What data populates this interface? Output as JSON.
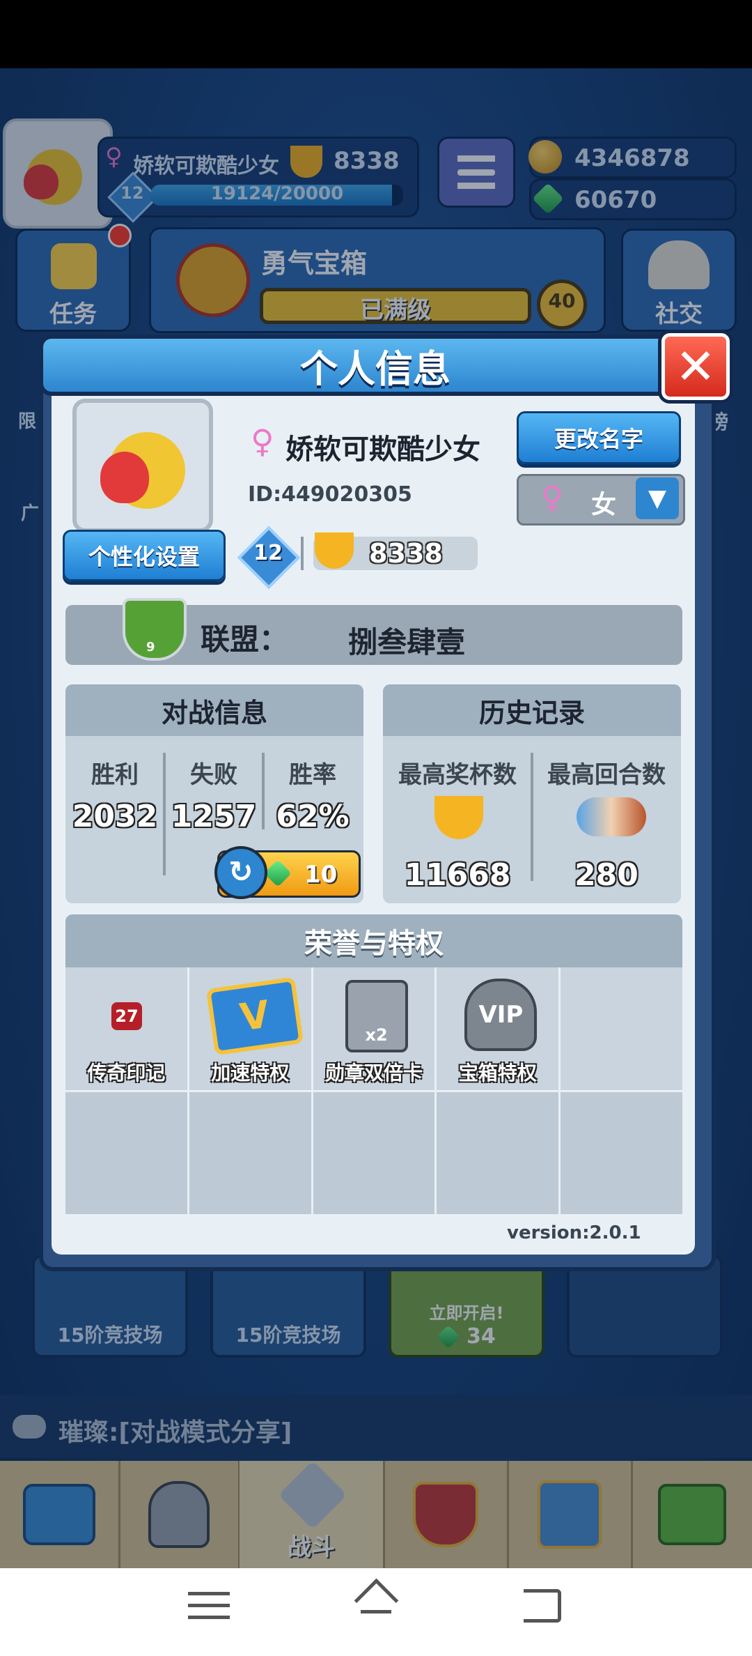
{
  "hud": {
    "player_name": "娇软可欺酷少女",
    "trophies": "8338",
    "level": "12",
    "xp": "19124/20000",
    "xp_progress": 0.956,
    "coins": "4346878",
    "gems": "60670"
  },
  "top_buttons": {
    "tasks_label": "任务",
    "chest_title": "勇气宝箱",
    "chest_status": "已满级",
    "chest_level": "40",
    "social_label": "社交"
  },
  "modal": {
    "title": "个人信息",
    "player_name": "娇软可欺酷少女",
    "player_id": "ID:449020305",
    "rename_button": "更改名字",
    "gender_value": "女",
    "personalize_button": "个性化设置",
    "level": "12",
    "trophies": "8338",
    "alliance_label": "联盟：",
    "alliance_name": "捌叁肆壹",
    "alliance_badge_level": "9",
    "battle_info": {
      "title": "对战信息",
      "wins_label": "胜利",
      "wins": "2032",
      "losses_label": "失败",
      "losses": "1257",
      "winrate_label": "胜率",
      "winrate": "62%",
      "reset_cost": "10"
    },
    "history": {
      "title": "历史记录",
      "max_trophies_label": "最高奖杯数",
      "max_trophies": "11668",
      "max_rounds_label": "最高回合数",
      "max_rounds": "280"
    },
    "honors": {
      "title": "荣誉与特权",
      "items": [
        {
          "label": "传奇印记",
          "badge": "27",
          "icon": "legend-mark-icon"
        },
        {
          "label": "加速特权",
          "icon": "speed-v-card-icon"
        },
        {
          "label": "勋章双倍卡",
          "icon": "double-medal-card-icon",
          "badge": "x2"
        },
        {
          "label": "宝箱特权",
          "icon": "vip-helmet-icon",
          "badge": "VIP"
        }
      ]
    },
    "version": "version:2.0.1"
  },
  "background": {
    "arena_label_1": "15阶竞技场",
    "arena_label_2": "15阶竞技场",
    "open_now": "立即开启!",
    "open_cost": "34",
    "chat_text": "璀璨:[对战模式分享]",
    "left_label_1": "限",
    "left_label_2": "广",
    "right_label": "榜",
    "battle_label": "战斗"
  },
  "colors": {
    "accent_blue": "#2d86cf",
    "close_red": "#d42a1c",
    "panel_bg": "#e9f0f5"
  }
}
